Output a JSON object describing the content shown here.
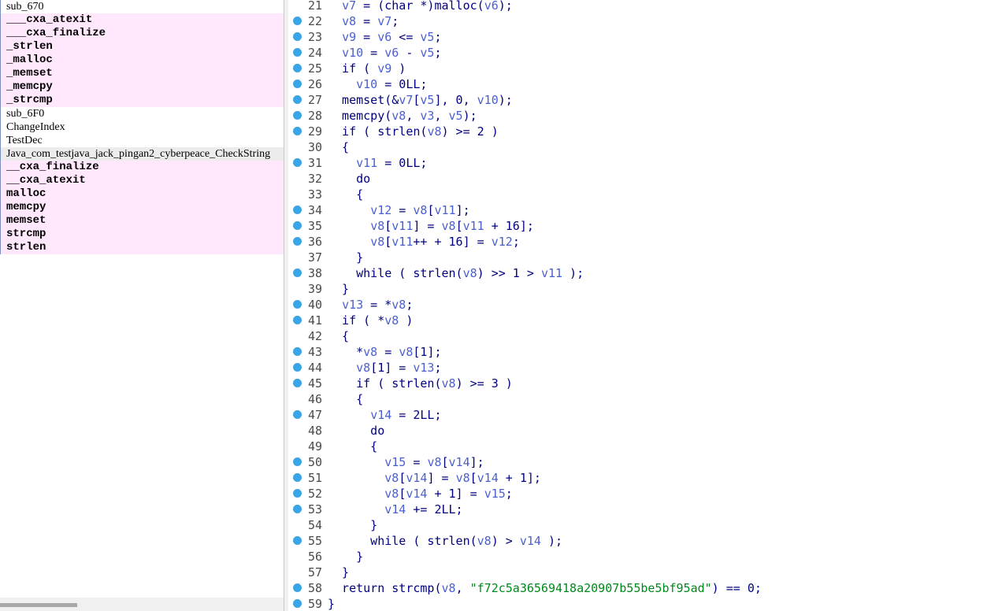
{
  "functions": [
    {
      "name": "sub_670",
      "kind": "normal"
    },
    {
      "name": "___cxa_atexit",
      "kind": "import"
    },
    {
      "name": "___cxa_finalize",
      "kind": "import"
    },
    {
      "name": "_strlen",
      "kind": "import"
    },
    {
      "name": "_malloc",
      "kind": "import"
    },
    {
      "name": "_memset",
      "kind": "import"
    },
    {
      "name": "_memcpy",
      "kind": "import"
    },
    {
      "name": "_strcmp",
      "kind": "import"
    },
    {
      "name": "sub_6F0",
      "kind": "normal"
    },
    {
      "name": "ChangeIndex",
      "kind": "normal"
    },
    {
      "name": "TestDec",
      "kind": "normal"
    },
    {
      "name": "Java_com_testjava_jack_pingan2_cyberpeace_CheckString",
      "kind": "selected"
    },
    {
      "name": "__cxa_finalize",
      "kind": "import"
    },
    {
      "name": "__cxa_atexit",
      "kind": "import"
    },
    {
      "name": "malloc",
      "kind": "import"
    },
    {
      "name": "memcpy",
      "kind": "import"
    },
    {
      "name": "memset",
      "kind": "import"
    },
    {
      "name": "strcmp",
      "kind": "import"
    },
    {
      "name": "strlen",
      "kind": "import"
    }
  ],
  "code": [
    {
      "n": "21",
      "dot": false,
      "t": [
        [
          "p",
          "  "
        ],
        [
          "v",
          "v7"
        ],
        [
          "p",
          " = (char *)malloc("
        ],
        [
          "v",
          "v6"
        ],
        [
          "p",
          ");"
        ]
      ]
    },
    {
      "n": "22",
      "dot": true,
      "t": [
        [
          "p",
          "  "
        ],
        [
          "v",
          "v8"
        ],
        [
          "p",
          " = "
        ],
        [
          "v",
          "v7"
        ],
        [
          "p",
          ";"
        ]
      ]
    },
    {
      "n": "23",
      "dot": true,
      "t": [
        [
          "p",
          "  "
        ],
        [
          "v",
          "v9"
        ],
        [
          "p",
          " = "
        ],
        [
          "v",
          "v6"
        ],
        [
          "p",
          " <= "
        ],
        [
          "v",
          "v5"
        ],
        [
          "p",
          ";"
        ]
      ]
    },
    {
      "n": "24",
      "dot": true,
      "t": [
        [
          "p",
          "  "
        ],
        [
          "v",
          "v10"
        ],
        [
          "p",
          " = "
        ],
        [
          "v",
          "v6"
        ],
        [
          "p",
          " - "
        ],
        [
          "v",
          "v5"
        ],
        [
          "p",
          ";"
        ]
      ]
    },
    {
      "n": "25",
      "dot": true,
      "t": [
        [
          "p",
          "  if ( "
        ],
        [
          "v",
          "v9"
        ],
        [
          "p",
          " )"
        ]
      ]
    },
    {
      "n": "26",
      "dot": true,
      "t": [
        [
          "p",
          "    "
        ],
        [
          "v",
          "v10"
        ],
        [
          "p",
          " = 0LL;"
        ]
      ]
    },
    {
      "n": "27",
      "dot": true,
      "t": [
        [
          "p",
          "  memset(&"
        ],
        [
          "v",
          "v7"
        ],
        [
          "p",
          "["
        ],
        [
          "v",
          "v5"
        ],
        [
          "p",
          "], 0, "
        ],
        [
          "v",
          "v10"
        ],
        [
          "p",
          ");"
        ]
      ]
    },
    {
      "n": "28",
      "dot": true,
      "t": [
        [
          "p",
          "  memcpy("
        ],
        [
          "v",
          "v8"
        ],
        [
          "p",
          ", "
        ],
        [
          "v",
          "v3"
        ],
        [
          "p",
          ", "
        ],
        [
          "v",
          "v5"
        ],
        [
          "p",
          ");"
        ]
      ]
    },
    {
      "n": "29",
      "dot": true,
      "t": [
        [
          "p",
          "  if ( strlen("
        ],
        [
          "v",
          "v8"
        ],
        [
          "p",
          ") >= 2 )"
        ]
      ]
    },
    {
      "n": "30",
      "dot": false,
      "t": [
        [
          "p",
          "  {"
        ]
      ]
    },
    {
      "n": "31",
      "dot": true,
      "t": [
        [
          "p",
          "    "
        ],
        [
          "v",
          "v11"
        ],
        [
          "p",
          " = 0LL;"
        ]
      ]
    },
    {
      "n": "32",
      "dot": false,
      "t": [
        [
          "p",
          "    do"
        ]
      ]
    },
    {
      "n": "33",
      "dot": false,
      "t": [
        [
          "p",
          "    {"
        ]
      ]
    },
    {
      "n": "34",
      "dot": true,
      "t": [
        [
          "p",
          "      "
        ],
        [
          "v",
          "v12"
        ],
        [
          "p",
          " = "
        ],
        [
          "v",
          "v8"
        ],
        [
          "p",
          "["
        ],
        [
          "v",
          "v11"
        ],
        [
          "p",
          "];"
        ]
      ]
    },
    {
      "n": "35",
      "dot": true,
      "t": [
        [
          "p",
          "      "
        ],
        [
          "v",
          "v8"
        ],
        [
          "p",
          "["
        ],
        [
          "v",
          "v11"
        ],
        [
          "p",
          "] = "
        ],
        [
          "v",
          "v8"
        ],
        [
          "p",
          "["
        ],
        [
          "v",
          "v11"
        ],
        [
          "p",
          " + 16];"
        ]
      ]
    },
    {
      "n": "36",
      "dot": true,
      "t": [
        [
          "p",
          "      "
        ],
        [
          "v",
          "v8"
        ],
        [
          "p",
          "["
        ],
        [
          "v",
          "v11"
        ],
        [
          "p",
          "++ + 16] = "
        ],
        [
          "v",
          "v12"
        ],
        [
          "p",
          ";"
        ]
      ]
    },
    {
      "n": "37",
      "dot": false,
      "t": [
        [
          "p",
          "    }"
        ]
      ]
    },
    {
      "n": "38",
      "dot": true,
      "t": [
        [
          "p",
          "    while ( strlen("
        ],
        [
          "v",
          "v8"
        ],
        [
          "p",
          ") >> 1 > "
        ],
        [
          "v",
          "v11"
        ],
        [
          "p",
          " );"
        ]
      ]
    },
    {
      "n": "39",
      "dot": false,
      "t": [
        [
          "p",
          "  }"
        ]
      ]
    },
    {
      "n": "40",
      "dot": true,
      "t": [
        [
          "p",
          "  "
        ],
        [
          "v",
          "v13"
        ],
        [
          "p",
          " = *"
        ],
        [
          "v",
          "v8"
        ],
        [
          "p",
          ";"
        ]
      ]
    },
    {
      "n": "41",
      "dot": true,
      "t": [
        [
          "p",
          "  if ( *"
        ],
        [
          "v",
          "v8"
        ],
        [
          "p",
          " )"
        ]
      ]
    },
    {
      "n": "42",
      "dot": false,
      "t": [
        [
          "p",
          "  {"
        ]
      ]
    },
    {
      "n": "43",
      "dot": true,
      "t": [
        [
          "p",
          "    *"
        ],
        [
          "v",
          "v8"
        ],
        [
          "p",
          " = "
        ],
        [
          "v",
          "v8"
        ],
        [
          "p",
          "[1];"
        ]
      ]
    },
    {
      "n": "44",
      "dot": true,
      "t": [
        [
          "p",
          "    "
        ],
        [
          "v",
          "v8"
        ],
        [
          "p",
          "[1] = "
        ],
        [
          "v",
          "v13"
        ],
        [
          "p",
          ";"
        ]
      ]
    },
    {
      "n": "45",
      "dot": true,
      "t": [
        [
          "p",
          "    if ( strlen("
        ],
        [
          "v",
          "v8"
        ],
        [
          "p",
          ") >= 3 )"
        ]
      ]
    },
    {
      "n": "46",
      "dot": false,
      "t": [
        [
          "p",
          "    {"
        ]
      ]
    },
    {
      "n": "47",
      "dot": true,
      "t": [
        [
          "p",
          "      "
        ],
        [
          "v",
          "v14"
        ],
        [
          "p",
          " = 2LL;"
        ]
      ]
    },
    {
      "n": "48",
      "dot": false,
      "t": [
        [
          "p",
          "      do"
        ]
      ]
    },
    {
      "n": "49",
      "dot": false,
      "t": [
        [
          "p",
          "      {"
        ]
      ]
    },
    {
      "n": "50",
      "dot": true,
      "t": [
        [
          "p",
          "        "
        ],
        [
          "v",
          "v15"
        ],
        [
          "p",
          " = "
        ],
        [
          "v",
          "v8"
        ],
        [
          "p",
          "["
        ],
        [
          "v",
          "v14"
        ],
        [
          "p",
          "];"
        ]
      ]
    },
    {
      "n": "51",
      "dot": true,
      "t": [
        [
          "p",
          "        "
        ],
        [
          "v",
          "v8"
        ],
        [
          "p",
          "["
        ],
        [
          "v",
          "v14"
        ],
        [
          "p",
          "] = "
        ],
        [
          "v",
          "v8"
        ],
        [
          "p",
          "["
        ],
        [
          "v",
          "v14"
        ],
        [
          "p",
          " + 1];"
        ]
      ]
    },
    {
      "n": "52",
      "dot": true,
      "t": [
        [
          "p",
          "        "
        ],
        [
          "v",
          "v8"
        ],
        [
          "p",
          "["
        ],
        [
          "v",
          "v14"
        ],
        [
          "p",
          " + 1] = "
        ],
        [
          "v",
          "v15"
        ],
        [
          "p",
          ";"
        ]
      ]
    },
    {
      "n": "53",
      "dot": true,
      "t": [
        [
          "p",
          "        "
        ],
        [
          "v",
          "v14"
        ],
        [
          "p",
          " += 2LL;"
        ]
      ]
    },
    {
      "n": "54",
      "dot": false,
      "t": [
        [
          "p",
          "      }"
        ]
      ]
    },
    {
      "n": "55",
      "dot": true,
      "t": [
        [
          "p",
          "      while ( strlen("
        ],
        [
          "v",
          "v8"
        ],
        [
          "p",
          ") > "
        ],
        [
          "v",
          "v14"
        ],
        [
          "p",
          " );"
        ]
      ]
    },
    {
      "n": "56",
      "dot": false,
      "t": [
        [
          "p",
          "    }"
        ]
      ]
    },
    {
      "n": "57",
      "dot": false,
      "t": [
        [
          "p",
          "  }"
        ]
      ]
    },
    {
      "n": "58",
      "dot": true,
      "t": [
        [
          "p",
          "  return strcmp("
        ],
        [
          "v",
          "v8"
        ],
        [
          "p",
          ", "
        ],
        [
          "s",
          "\"f72c5a36569418a20907b55be5bf95ad\""
        ],
        [
          "p",
          ") == 0;"
        ]
      ]
    },
    {
      "n": "59",
      "dot": true,
      "t": [
        [
          "p",
          "}"
        ]
      ]
    }
  ],
  "colors": {
    "variable": "#4a5fcf",
    "string": "#00891c",
    "code": "#000080",
    "import_bg": "#ffe8fc",
    "breakpoint_dot": "#3aa5e6"
  }
}
